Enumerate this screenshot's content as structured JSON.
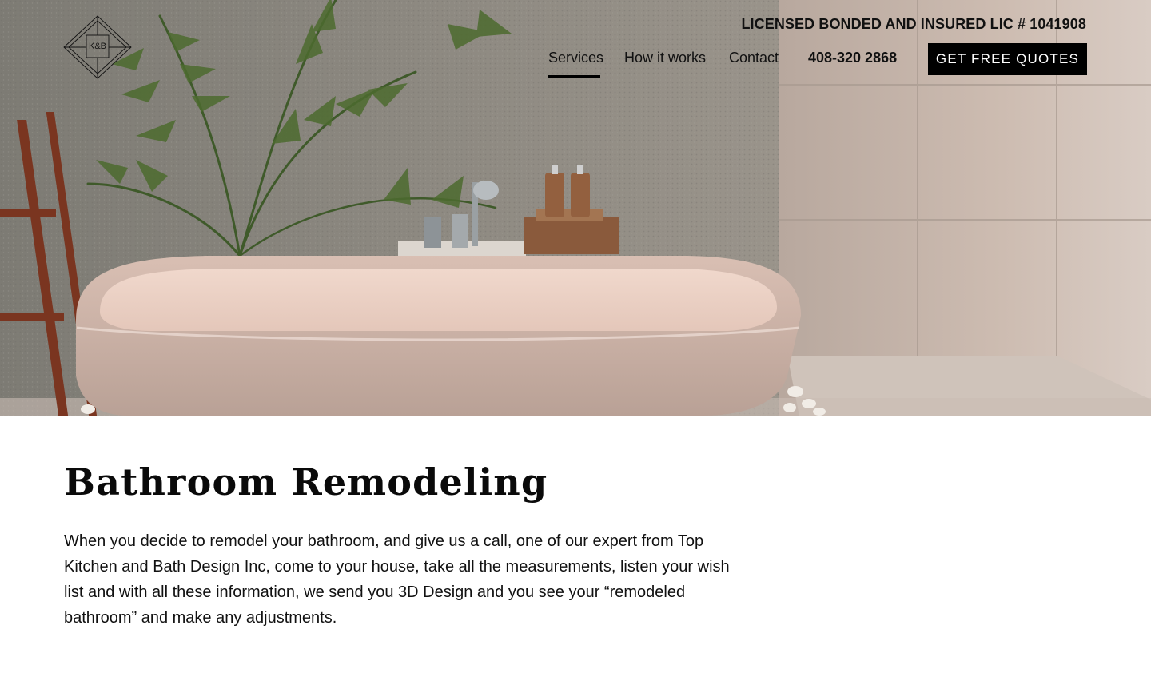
{
  "header": {
    "logo_text": "K&B",
    "license_text": "LICENSED BONDED AND INSURED LIC ",
    "license_number": "# 1041908",
    "nav": {
      "services": "Services",
      "how_it_works": "How it works",
      "contact": "Contact"
    },
    "phone": "408-320 2868",
    "cta": "GET FREE QUOTES"
  },
  "hero": {
    "image": "bathroom-bathtub-photo"
  },
  "main": {
    "title": "Bathroom Remodeling",
    "body": "When you decide to remodel your bathroom, and give us a call, one of our expert from Top Kitchen and Bath Design Inc, come to your house, take all the measurements, listen your wish list and with all these information, we send you 3D Design and you see your “remodeled bathroom” and make any adjustments."
  }
}
